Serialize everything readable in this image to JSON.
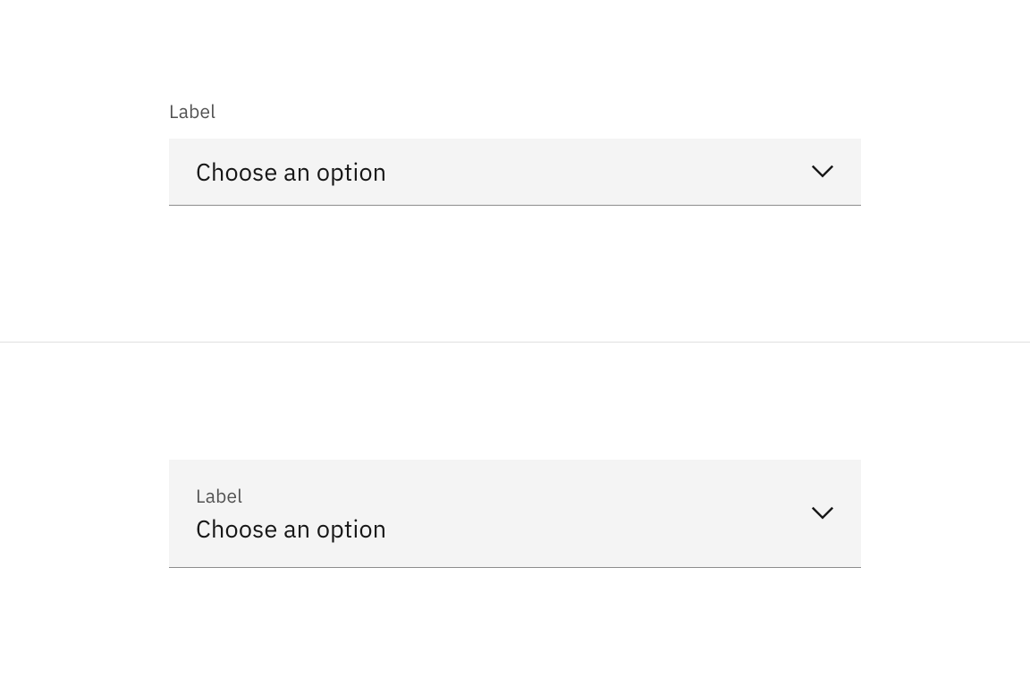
{
  "dropdown1": {
    "label": "Label",
    "placeholder": "Choose an option"
  },
  "dropdown2": {
    "label": "Label",
    "placeholder": "Choose an option"
  }
}
